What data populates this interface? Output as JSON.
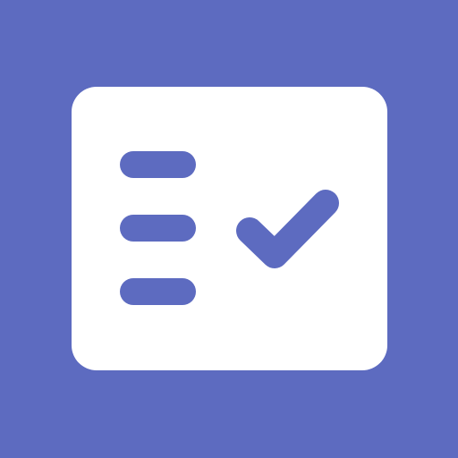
{
  "icon": {
    "name": "checklist-app-icon",
    "depicts": "checklist-icon",
    "colors": {
      "background": "#5D6BC0",
      "card": "#FFFFFF",
      "glyph": "#5D6BC0"
    },
    "list_lines_count": 3,
    "checkmark": true
  }
}
